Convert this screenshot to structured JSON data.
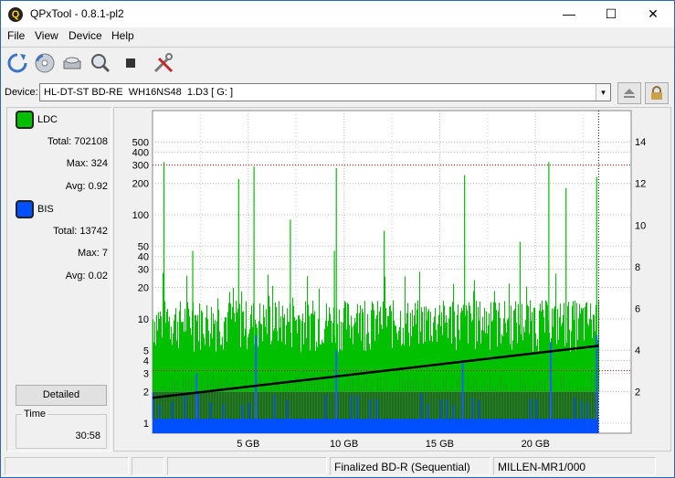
{
  "window": {
    "title": "QPxTool - 0.8.1-pl2",
    "app_icon_glyph": "Q"
  },
  "window_controls": {
    "minimize": "—",
    "maximize": "☐",
    "close": "✕"
  },
  "menu": [
    "File",
    "View",
    "Device",
    "Help"
  ],
  "toolbar": {
    "icons": [
      "refresh-icon",
      "disc-scan-icon",
      "drive-info-icon",
      "zoom-icon",
      "stop-icon",
      "tools-icon"
    ]
  },
  "device": {
    "label": "Device:",
    "selected": "HL-DT-ST BD-RE  WH16NS48  1.D3 [ G: ]",
    "arrow": "▾",
    "eject_icon": "eject-icon",
    "lock_icon": "lock-icon"
  },
  "legend": {
    "ldc": {
      "name": "LDC",
      "color": "#00c000",
      "total_label": "Total: 702108",
      "max_label": "Max: 324",
      "avg_label": "Avg: 0.92"
    },
    "bis": {
      "name": "BIS",
      "color": "#0050ff",
      "total_label": "Total: 13742",
      "max_label": "Max: 7",
      "avg_label": "Avg: 0.02"
    }
  },
  "detailed_button": "Detailed",
  "time": {
    "title": "Time",
    "value": "30:58"
  },
  "status": {
    "cell1": "",
    "cell2": "",
    "cell3": "Finalized BD-R (Sequential)",
    "cell4": "MILLEN-MR1/000"
  },
  "chart_data": {
    "type": "bar",
    "x_label": "",
    "x_ticks": [
      "5 GB",
      "10 GB",
      "15 GB",
      "20 GB"
    ],
    "x_tick_values": [
      5,
      10,
      15,
      20
    ],
    "x_range": [
      0,
      25
    ],
    "data_end_x": 23.3,
    "y_left_scale": "log",
    "y_left_ticks": [
      "1",
      "2",
      "3",
      "4",
      "5",
      "10",
      "20",
      "30",
      "40",
      "50",
      "100",
      "200",
      "300",
      "400",
      "500"
    ],
    "y_left_tick_values": [
      1,
      2,
      3,
      4,
      5,
      10,
      20,
      30,
      40,
      50,
      100,
      200,
      300,
      400,
      500
    ],
    "y_left_range": [
      0.8,
      1000
    ],
    "y_right_ticks": [
      "2",
      "4",
      "6",
      "8",
      "10",
      "12",
      "14"
    ],
    "y_right_tick_values": [
      2,
      4,
      6,
      8,
      10,
      12,
      14
    ],
    "y_right_range": [
      0,
      15.5
    ],
    "red_limit_left": 300,
    "red_limit_right": 3,
    "series": [
      {
        "name": "LDC",
        "color": "#00c000",
        "baseline": 8,
        "spikes": [
          [
            0.6,
            320
          ],
          [
            2.1,
            45
          ],
          [
            4.5,
            220
          ],
          [
            5.3,
            290
          ],
          [
            7.2,
            90
          ],
          [
            9.5,
            45
          ],
          [
            9.6,
            280
          ],
          [
            12.1,
            70
          ],
          [
            16.3,
            240
          ],
          [
            19.2,
            55
          ],
          [
            20.7,
            320
          ],
          [
            21.6,
            180
          ],
          [
            23.2,
            230
          ]
        ]
      },
      {
        "name": "BIS",
        "color": "#0050ff",
        "baseline": 1.1,
        "spikes": [
          [
            2.3,
            3
          ],
          [
            5.4,
            7
          ],
          [
            9.6,
            5
          ],
          [
            16.2,
            4
          ],
          [
            20.8,
            6
          ],
          [
            23.2,
            7
          ]
        ]
      },
      {
        "name": "Speed",
        "color": "#000000",
        "start": 1.7,
        "end": 4.2
      }
    ]
  }
}
